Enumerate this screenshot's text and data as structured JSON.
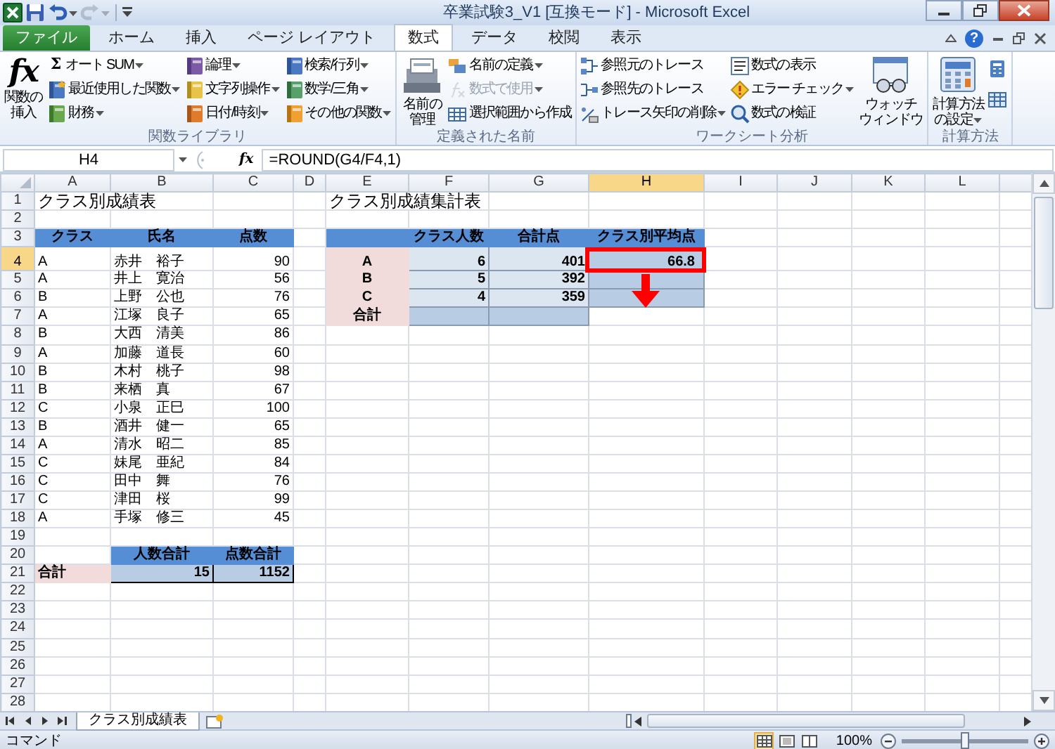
{
  "window": {
    "title": "卒業試験3_V1 [互換モード] - Microsoft Excel"
  },
  "quick_access": [
    {
      "disabled": false,
      "dropdown": false
    },
    {
      "disabled": false,
      "dropdown": true
    },
    {
      "disabled": true,
      "dropdown": true
    }
  ],
  "ribbon_tabs": [
    {
      "label": "ファイル",
      "kind": "file",
      "selected": false
    },
    {
      "label": "ホーム",
      "kind": "tab",
      "selected": false
    },
    {
      "label": "挿入",
      "kind": "tab",
      "selected": false
    },
    {
      "label": "ページ レイアウト",
      "kind": "tab",
      "selected": false
    },
    {
      "label": "数式",
      "kind": "tab",
      "selected": true
    },
    {
      "label": "データ",
      "kind": "tab",
      "selected": false
    },
    {
      "label": "校閲",
      "kind": "tab",
      "selected": false
    },
    {
      "label": "表示",
      "kind": "tab",
      "selected": false
    }
  ],
  "help": "?",
  "ribbon_groups": [
    {
      "label": "関数ライブラリ",
      "columns": [
        [
          {
            "kind": "large",
            "lines": [
              "関数の",
              "挿入"
            ],
            "glyph": "fx",
            "dropdown": false
          }
        ],
        [
          {
            "kind": "small",
            "glyph": "Σ",
            "label": "オート SUM",
            "dropdown": true,
            "disabled": false
          },
          {
            "kind": "small",
            "label": "最近使用した関数",
            "dropdown": true,
            "disabled": false
          },
          {
            "kind": "small",
            "label": "財務",
            "dropdown": true,
            "disabled": false
          }
        ],
        [
          {
            "kind": "small",
            "label": "論理",
            "dropdown": true,
            "disabled": false
          },
          {
            "kind": "small",
            "label": "文字列操作",
            "dropdown": true,
            "disabled": false
          },
          {
            "kind": "small",
            "label": "日付/時刻",
            "dropdown": true,
            "disabled": false
          }
        ],
        [
          {
            "kind": "small",
            "label": "検索/行列",
            "dropdown": true,
            "disabled": false
          },
          {
            "kind": "small",
            "label": "数学/三角",
            "dropdown": true,
            "disabled": false
          },
          {
            "kind": "small",
            "label": "その他の関数",
            "dropdown": true,
            "disabled": false
          }
        ]
      ]
    },
    {
      "label": "定義された名前",
      "columns": [
        [
          {
            "kind": "large",
            "lines": [
              "名前の",
              "管理"
            ],
            "dropdown": false
          }
        ],
        [
          {
            "kind": "small",
            "label": "名前の定義",
            "dropdown": true,
            "disabled": false
          },
          {
            "kind": "small",
            "label": "数式で使用",
            "dropdown": true,
            "disabled": true
          },
          {
            "kind": "small",
            "label": "選択範囲から作成",
            "dropdown": false,
            "disabled": false
          }
        ]
      ]
    },
    {
      "label": "ワークシート分析",
      "columns": [
        [
          {
            "kind": "small",
            "label": "参照元のトレース",
            "dropdown": false,
            "disabled": false
          },
          {
            "kind": "small",
            "label": "参照先のトレース",
            "dropdown": false,
            "disabled": false
          },
          {
            "kind": "small",
            "label": "トレース矢印の削除",
            "dropdown": true,
            "disabled": false
          }
        ],
        [
          {
            "kind": "small",
            "label": "数式の表示",
            "dropdown": false,
            "disabled": false
          },
          {
            "kind": "small",
            "label": "エラー チェック",
            "dropdown": true,
            "disabled": false
          },
          {
            "kind": "small",
            "label": "数式の検証",
            "dropdown": false,
            "disabled": false
          }
        ],
        [
          {
            "kind": "large",
            "lines": [
              "ウォッチ",
              "ウィンドウ"
            ],
            "dropdown": false
          }
        ]
      ]
    },
    {
      "label": "計算方法",
      "columns": [
        [
          {
            "kind": "large",
            "lines": [
              "計算方法",
              "の設定"
            ],
            "dropdown": true
          }
        ],
        [
          {
            "kind": "icon"
          },
          {
            "kind": "icon"
          }
        ]
      ]
    }
  ],
  "formula_bar": {
    "name_box": "H4",
    "function_glyph": "fx",
    "formula": "=ROUND(G4/F4,1)"
  },
  "columns": [
    {
      "label": "A",
      "selected": false
    },
    {
      "label": "B",
      "selected": false
    },
    {
      "label": "C",
      "selected": false
    },
    {
      "label": "D",
      "selected": false
    },
    {
      "label": "E",
      "selected": false
    },
    {
      "label": "F",
      "selected": false
    },
    {
      "label": "G",
      "selected": false
    },
    {
      "label": "H",
      "selected": true
    },
    {
      "label": "I",
      "selected": false
    },
    {
      "label": "J",
      "selected": false
    },
    {
      "label": "K",
      "selected": false
    },
    {
      "label": "L",
      "selected": false
    }
  ],
  "rows": [
    {
      "number": "1",
      "selected": false,
      "cells": {
        "A": {
          "kind": "title",
          "text": "クラス別成績表"
        },
        "E": {
          "kind": "title",
          "text": "クラス別成績集計表"
        }
      }
    },
    {
      "number": "2",
      "selected": false
    },
    {
      "number": "3",
      "selected": false,
      "cells": {
        "A": {
          "kind": "header",
          "text": "クラス"
        },
        "B": {
          "kind": "header",
          "text": "氏名"
        },
        "C": {
          "kind": "header",
          "text": "点数"
        },
        "E": {
          "kind": "header"
        },
        "F": {
          "kind": "header",
          "text": "クラス人数"
        },
        "G": {
          "kind": "header",
          "text": "合計点"
        },
        "H": {
          "kind": "header",
          "text": "クラス別平均点"
        }
      }
    },
    {
      "number": "4",
      "selected": true,
      "cells": {
        "A": {
          "kind": "text",
          "text": "A"
        },
        "B": {
          "kind": "text",
          "text": "赤井　裕子"
        },
        "C": {
          "kind": "number",
          "text": "90"
        },
        "E": {
          "kind": "label",
          "text": "A"
        },
        "F": {
          "kind": "value",
          "text": "6"
        },
        "G": {
          "kind": "value",
          "text": "401"
        },
        "H": {
          "kind": "result",
          "text": "66.8",
          "annotation": {
            "kind": "box"
          }
        }
      }
    },
    {
      "number": "5",
      "selected": false,
      "cells": {
        "A": {
          "kind": "text",
          "text": "A"
        },
        "B": {
          "kind": "text",
          "text": "井上　寛治"
        },
        "C": {
          "kind": "number",
          "text": "56"
        },
        "E": {
          "kind": "label",
          "text": "B"
        },
        "F": {
          "kind": "value",
          "text": "5"
        },
        "G": {
          "kind": "value",
          "text": "392"
        },
        "H": {
          "kind": "result",
          "annotation": {
            "kind": "arrow"
          }
        }
      }
    },
    {
      "number": "6",
      "selected": false,
      "cells": {
        "A": {
          "kind": "text",
          "text": "B"
        },
        "B": {
          "kind": "text",
          "text": "上野　公也"
        },
        "C": {
          "kind": "number",
          "text": "76"
        },
        "E": {
          "kind": "label",
          "text": "C"
        },
        "F": {
          "kind": "value",
          "text": "4"
        },
        "G": {
          "kind": "value",
          "text": "359"
        },
        "H": {
          "kind": "result"
        }
      }
    },
    {
      "number": "7",
      "selected": false,
      "cells": {
        "A": {
          "kind": "text",
          "text": "A"
        },
        "B": {
          "kind": "text",
          "text": "江塚　良子"
        },
        "C": {
          "kind": "number",
          "text": "65"
        },
        "E": {
          "kind": "label",
          "text": "合計"
        },
        "F": {
          "kind": "result"
        },
        "G": {
          "kind": "result"
        }
      }
    },
    {
      "number": "8",
      "selected": false,
      "cells": {
        "A": {
          "kind": "text",
          "text": "B"
        },
        "B": {
          "kind": "text",
          "text": "大西　清美"
        },
        "C": {
          "kind": "number",
          "text": "86"
        }
      }
    },
    {
      "number": "9",
      "selected": false,
      "cells": {
        "A": {
          "kind": "text",
          "text": "A"
        },
        "B": {
          "kind": "text",
          "text": "加藤　道長"
        },
        "C": {
          "kind": "number",
          "text": "60"
        }
      }
    },
    {
      "number": "10",
      "selected": false,
      "cells": {
        "A": {
          "kind": "text",
          "text": "B"
        },
        "B": {
          "kind": "text",
          "text": "木村　桃子"
        },
        "C": {
          "kind": "number",
          "text": "98"
        }
      }
    },
    {
      "number": "11",
      "selected": false,
      "cells": {
        "A": {
          "kind": "text",
          "text": "B"
        },
        "B": {
          "kind": "text",
          "text": "来栖　真"
        },
        "C": {
          "kind": "number",
          "text": "67"
        }
      }
    },
    {
      "number": "12",
      "selected": false,
      "cells": {
        "A": {
          "kind": "text",
          "text": "C"
        },
        "B": {
          "kind": "text",
          "text": "小泉　正巳"
        },
        "C": {
          "kind": "number",
          "text": "100"
        }
      }
    },
    {
      "number": "13",
      "selected": false,
      "cells": {
        "A": {
          "kind": "text",
          "text": "B"
        },
        "B": {
          "kind": "text",
          "text": "酒井　健一"
        },
        "C": {
          "kind": "number",
          "text": "65"
        }
      }
    },
    {
      "number": "14",
      "selected": false,
      "cells": {
        "A": {
          "kind": "text",
          "text": "A"
        },
        "B": {
          "kind": "text",
          "text": "清水　昭二"
        },
        "C": {
          "kind": "number",
          "text": "85"
        }
      }
    },
    {
      "number": "15",
      "selected": false,
      "cells": {
        "A": {
          "kind": "text",
          "text": "C"
        },
        "B": {
          "kind": "text",
          "text": "妹尾　亜紀"
        },
        "C": {
          "kind": "number",
          "text": "84"
        }
      }
    },
    {
      "number": "16",
      "selected": false,
      "cells": {
        "A": {
          "kind": "text",
          "text": "C"
        },
        "B": {
          "kind": "text",
          "text": "田中　舞"
        },
        "C": {
          "kind": "number",
          "text": "76"
        }
      }
    },
    {
      "number": "17",
      "selected": false,
      "cells": {
        "A": {
          "kind": "text",
          "text": "C"
        },
        "B": {
          "kind": "text",
          "text": "津田　桜"
        },
        "C": {
          "kind": "number",
          "text": "99"
        }
      }
    },
    {
      "number": "18",
      "selected": false,
      "cells": {
        "A": {
          "kind": "text",
          "text": "A"
        },
        "B": {
          "kind": "text",
          "text": "手塚　修三"
        },
        "C": {
          "kind": "number",
          "text": "45"
        }
      }
    },
    {
      "number": "19",
      "selected": false
    },
    {
      "number": "20",
      "selected": false,
      "cells": {
        "B": {
          "kind": "header",
          "text": "人数合計"
        },
        "C": {
          "kind": "header",
          "text": "点数合計"
        }
      }
    },
    {
      "number": "21",
      "selected": false,
      "cells": {
        "A": {
          "kind": "label-left",
          "text": "合計"
        },
        "B": {
          "kind": "total",
          "text": "15"
        },
        "C": {
          "kind": "total",
          "text": "1152"
        }
      }
    },
    {
      "number": "22",
      "selected": false
    },
    {
      "number": "23",
      "selected": false
    },
    {
      "number": "24",
      "selected": false
    },
    {
      "number": "25",
      "selected": false
    },
    {
      "number": "26",
      "selected": false
    },
    {
      "number": "27",
      "selected": false
    },
    {
      "number": "28",
      "selected": false
    }
  ],
  "sheet_tabs": [
    {
      "label": "クラス別成績表",
      "selected": true
    }
  ],
  "status_bar": {
    "mode": "コマンド",
    "views": [
      {
        "selected": true
      },
      {
        "selected": false
      },
      {
        "selected": false
      }
    ],
    "zoom": "100%",
    "zoom_slider": {
      "level": 0.5
    }
  }
}
